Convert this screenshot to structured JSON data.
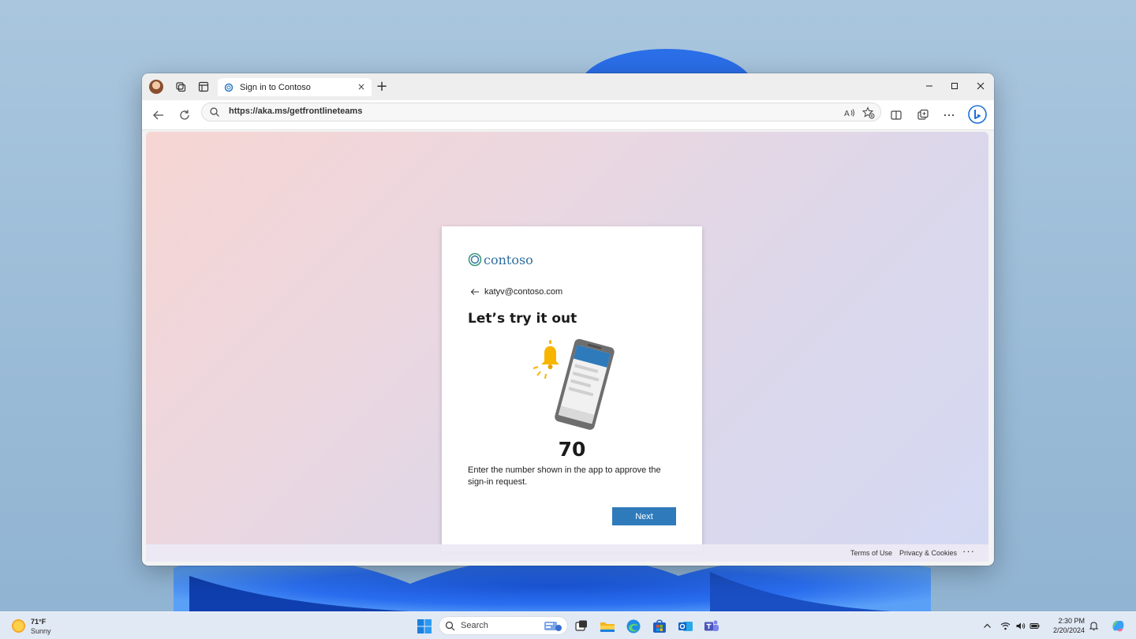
{
  "browser": {
    "tab_title": "Sign in to Contoso",
    "new_tab_label": "+",
    "tab_close_label": "×",
    "url": "https://aka.ms/getfrontlineteams"
  },
  "page": {
    "brand": "contoso",
    "identity": "katyv@contoso.com",
    "heading": "Let’s try it out",
    "number": "70",
    "description": "Enter the number shown in the app to approve the sign-in request.",
    "next_label": "Next"
  },
  "footer": {
    "terms": "Terms of Use",
    "privacy": "Privacy & Cookies",
    "more": "···"
  },
  "taskbar": {
    "weather_temp": "71°F",
    "weather_condition": "Sunny",
    "search_placeholder": "Search",
    "clock_time": "2:30 PM",
    "clock_date": "2/20/2024"
  },
  "colors": {
    "accent": "#2f7abb",
    "brand": "#2e6e9e",
    "bell": "#f7b500"
  },
  "icons": [
    "back-icon",
    "refresh-icon",
    "search-icon",
    "read-aloud-icon",
    "favorites-icon",
    "split-screen-icon",
    "collections-icon",
    "more-icon",
    "copilot-icon",
    "bell-icon",
    "phone-icon"
  ]
}
